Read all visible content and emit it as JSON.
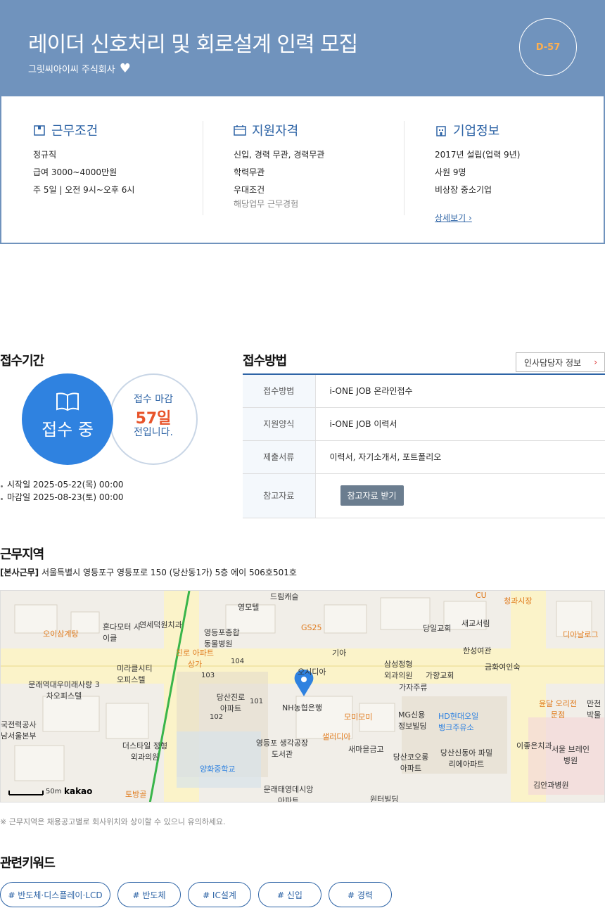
{
  "header": {
    "title": "레이더 신호처리 및 회로설계 인력 모집",
    "company": "그릿씨아이씨 주식회사",
    "dday": "D-57"
  },
  "conditions": {
    "title": "근무조건",
    "items": [
      "정규직",
      "급여 3000~4000만원",
      "주 5일 | 오전 9시~오후 6시"
    ]
  },
  "qualifications": {
    "title": "지원자격",
    "items": [
      "신입, 경력 무관, 경력무관",
      "학력무관",
      "우대조건"
    ],
    "sub": "해당업무 근무경험"
  },
  "company_info": {
    "title": "기업정보",
    "items": [
      "2017년 설립(업력 9년)",
      "사원 9명",
      "비상장 중소기업"
    ],
    "more": "상세보기"
  },
  "period": {
    "title": "접수기간",
    "status": "접수 중",
    "deadline_line1": "접수 마감",
    "deadline_days": "57일",
    "deadline_line3": "전입니다.",
    "start": "시작일 2025-05-22(목) 00:00",
    "end": "마감일 2025-08-23(토) 00:00"
  },
  "method": {
    "title": "접수방법",
    "hr_button": "인사담당자 정보",
    "rows": [
      {
        "k": "접수방법",
        "v": "i-ONE JOB 온라인접수"
      },
      {
        "k": "지원양식",
        "v": "i-ONE JOB 이력서"
      },
      {
        "k": "제출서류",
        "v": "이력서, 자기소개서, 포트폴리오"
      },
      {
        "k": "참고자료",
        "v": "참고자료 받기"
      }
    ]
  },
  "location": {
    "title": "근무지역",
    "tag": "[본사근무]",
    "address": "서울특별시 영등포구 영등포로 150 (당산동1가) 5층 에이 506호501호",
    "note": "※ 근무지역은 채용공고별로 회사위치와 상이할 수 있으니 유의하세요.",
    "map_labels": [
      "드림캐슬",
      "영모텔",
      "혼다모터 사이클",
      "연세덕원치과",
      "영등포종합 동물병원",
      "GS25",
      "오이삼계탕",
      "미라클시티 오피스텔",
      "문래역대우미래사랑 3차오피스텔",
      "진로 아파트상가",
      "당산진로 아파트",
      "기아",
      "오시디아",
      "NH농협은행",
      "모미모미",
      "삼성정형 외과의원",
      "가자주류",
      "가향교회",
      "MG신용 정보빌딩",
      "HD현대오일 뱅크주유소",
      "당일교회",
      "새교서림",
      "한성여관",
      "금화여인숙",
      "디아날로그",
      "윤달 오리전문점",
      "만천 박물",
      "이좋은치과",
      "서울 브레인병원",
      "김안과병원",
      "당산신동아 파밀리에아파트",
      "당산코오롱 아파트",
      "새마을금고",
      "샐러디아",
      "영등포 생각공장도서관",
      "더스타일 정형외과의원",
      "양화중학교",
      "문래태영데시앙 아파트",
      "토방골",
      "원터빌딩",
      "국전력공사 남서울본부",
      "CU",
      "청과시장",
      "101",
      "102",
      "103",
      "104"
    ],
    "scale": "50m",
    "brand": "kakao"
  },
  "keywords": {
    "title": "관련키워드",
    "items": [
      "# 반도체·디스플레이·LCD",
      "# 반도체",
      "# IC설계",
      "# 신입",
      "# 경력"
    ]
  },
  "colors": {
    "primary": "#2e64a6",
    "hero": "#7093bd",
    "accent": "#e8542b",
    "status": "#2f82e0"
  }
}
